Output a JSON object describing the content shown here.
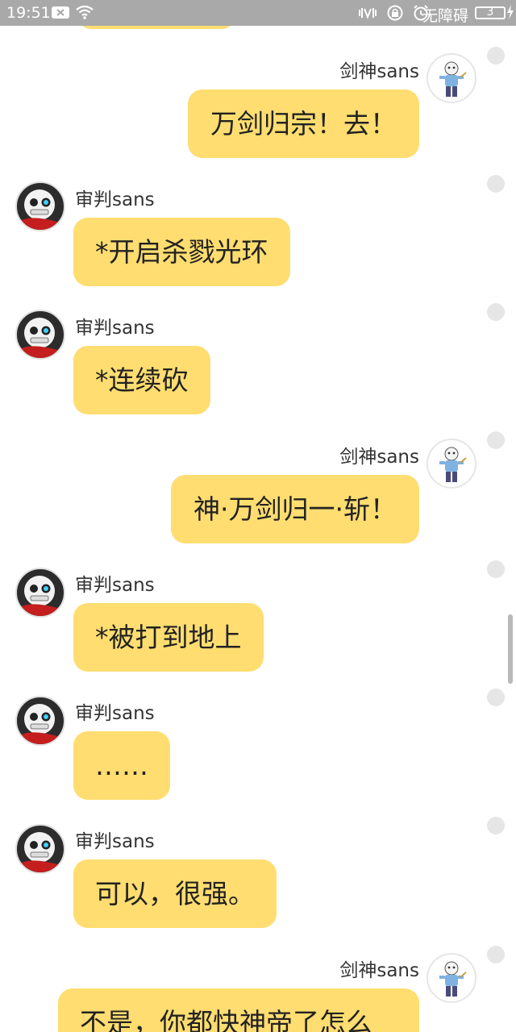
{
  "status_bar": {
    "time": "19:51",
    "accessibility": "无障碍",
    "battery": "3"
  },
  "messages": [
    {
      "side": "right",
      "name": "剑神sans",
      "text": "万剑归宗！去！"
    },
    {
      "side": "left",
      "name": "审判sans",
      "text": "*开启杀戮光环"
    },
    {
      "side": "left",
      "name": "审判sans",
      "text": "*连续砍"
    },
    {
      "side": "right",
      "name": "剑神sans",
      "text": "神·万剑归一·斩！"
    },
    {
      "side": "left",
      "name": "审判sans",
      "text": "*被打到地上"
    },
    {
      "side": "left",
      "name": "审判sans",
      "text": "……"
    },
    {
      "side": "left",
      "name": "审判sans",
      "text": "可以，很强。"
    },
    {
      "side": "right",
      "name": "剑神sans",
      "text": "不是，你都快神帝了怎么"
    }
  ],
  "colors": {
    "bubble": "#ffdd70",
    "status_bar": "#a9a9a9"
  }
}
